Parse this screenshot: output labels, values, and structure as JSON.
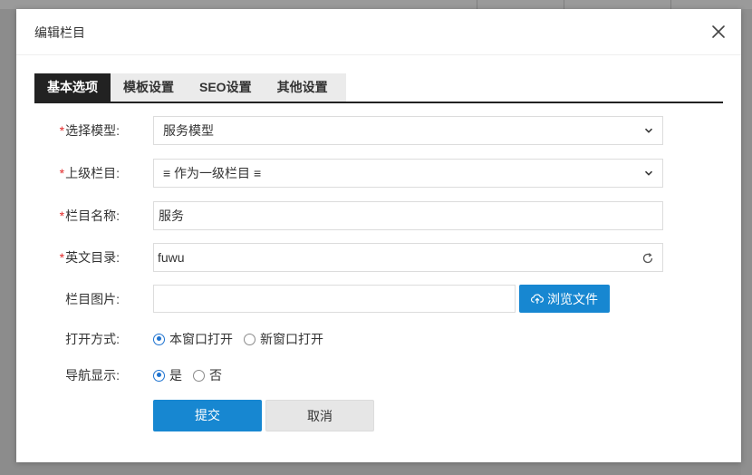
{
  "dialog": {
    "title": "编辑栏目",
    "close_icon": "close-icon"
  },
  "tabs": [
    {
      "label": "基本选项",
      "active": true
    },
    {
      "label": "模板设置",
      "active": false
    },
    {
      "label": "SEO设置",
      "active": false
    },
    {
      "label": "其他设置",
      "active": false
    }
  ],
  "form": {
    "model": {
      "label": "选择模型:",
      "required": true,
      "value": "服务模型"
    },
    "parent": {
      "label": "上级栏目:",
      "required": true,
      "value": "≡ 作为一级栏目 ≡"
    },
    "name": {
      "label": "栏目名称:",
      "required": true,
      "value": "服务"
    },
    "dir": {
      "label": "英文目录:",
      "required": true,
      "value": "fuwu"
    },
    "image": {
      "label": "栏目图片:",
      "value": "",
      "browse_label": "浏览文件"
    },
    "open_mode": {
      "label": "打开方式:",
      "options": [
        "本窗口打开",
        "新窗口打开"
      ],
      "selected": "本窗口打开"
    },
    "nav_show": {
      "label": "导航显示:",
      "options": [
        "是",
        "否"
      ],
      "selected": "是"
    }
  },
  "actions": {
    "submit_label": "提交",
    "cancel_label": "取消"
  },
  "colors": {
    "primary": "#1787d1",
    "required": "#e32b2b",
    "tab_active": "#222222"
  },
  "required_mark": "*"
}
